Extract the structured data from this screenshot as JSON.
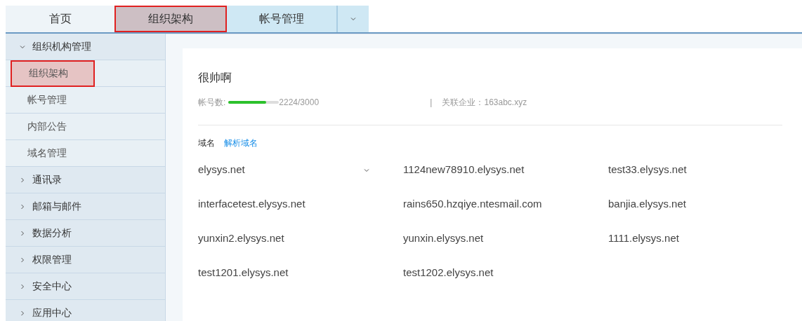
{
  "tabs": [
    {
      "label": "首页",
      "selected": false,
      "highlighted": false
    },
    {
      "label": "组织架构",
      "selected": true,
      "highlighted": true
    },
    {
      "label": "帐号管理",
      "selected": false,
      "highlighted": false
    }
  ],
  "tab_menu": {
    "expanded": false
  },
  "sidebar": {
    "items": [
      {
        "label": "组织机构管理",
        "expanded": true,
        "children": [
          {
            "label": "组织架构",
            "selected": true,
            "highlighted": true
          },
          {
            "label": "帐号管理",
            "selected": false,
            "highlighted": false
          },
          {
            "label": "内部公告",
            "selected": false,
            "highlighted": false
          },
          {
            "label": "域名管理",
            "selected": false,
            "highlighted": false
          }
        ]
      },
      {
        "label": "通讯录",
        "expanded": false
      },
      {
        "label": "邮箱与邮件",
        "expanded": false
      },
      {
        "label": "数据分析",
        "expanded": false
      },
      {
        "label": "权限管理",
        "expanded": false
      },
      {
        "label": "安全中心",
        "expanded": false
      },
      {
        "label": "应用中心",
        "expanded": false
      }
    ]
  },
  "org": {
    "name": "很帅啊",
    "accounts_label": "帐号数:",
    "accounts_meter": {
      "level": 0.74
    },
    "accounts_reading": "2224/3000",
    "separator": "|",
    "company": "关联企业：163abc.xyz"
  },
  "domains": {
    "label": "域名",
    "link": "解析域名",
    "items": [
      {
        "kind": "dropdown",
        "text": "elysys.net"
      },
      {
        "kind": "plain",
        "text": "1124new78910.elysys.net"
      },
      {
        "kind": "plain",
        "text": "test33.elysys.net"
      },
      {
        "kind": "plain",
        "text": "interfacetest.elysys.net"
      },
      {
        "kind": "plain",
        "text": "rains650.hzqiye.ntesmail.com"
      },
      {
        "kind": "plain",
        "text": "banjia.elysys.net"
      },
      {
        "kind": "plain",
        "text": "yunxin2.elysys.net"
      },
      {
        "kind": "plain",
        "text": "yunxin.elysys.net"
      },
      {
        "kind": "plain",
        "text": "1111.elysys.net"
      },
      {
        "kind": "plain",
        "text": "test1201.elysys.net"
      },
      {
        "kind": "plain",
        "text": "test1202.elysys.net"
      }
    ]
  }
}
